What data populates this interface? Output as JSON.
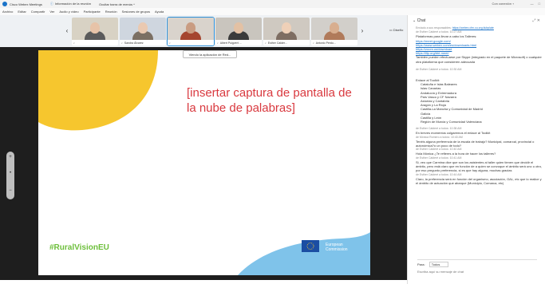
{
  "titlebar": {
    "app": "Cisco Webex Meetings",
    "info": "Información de la reunión",
    "hide": "Ocultar barra de menús ^",
    "connected": "Con conexión ∘",
    "win_min": "—",
    "win_close": "□"
  },
  "menu": [
    "Archivo",
    "Editar",
    "Compartir",
    "Ver",
    "Audio y vídeo",
    "Participante",
    "Reunión",
    "Sesiones de grupos",
    "Ayuda"
  ],
  "participants": [
    {
      "name": "",
      "bg": "#d8d2c4",
      "skin": "#e7c3a8",
      "shirt": "#5b5b5b"
    },
    {
      "name": "Sandra Álvarez",
      "bg": "#cfd6df",
      "skin": "#eac9b1",
      "shirt": "#7b6f63"
    },
    {
      "name": "",
      "bg": "#d9d3cc",
      "skin": "#c99c82",
      "shirt": "#a5452f",
      "active": true
    },
    {
      "name": "Albert Puigvert ...",
      "bg": "#c9c5be",
      "skin": "#e3c1a4",
      "shirt": "#3b3b3b"
    },
    {
      "name": "Esther Calder...",
      "bg": "#cfc9c1",
      "skin": "#efd0b8",
      "shirt": "#7e6d62"
    },
    {
      "name": "Antonio Perdo...",
      "bg": "#d2cfca",
      "skin": "#d8ae8f",
      "shirt": "#b07a5a"
    }
  ],
  "design_label": "Diseño",
  "viewing_label": "Viendo la aplicación de Red...",
  "slide": {
    "placeholder": "[insertar captura de pantalla de la nube de palabras]",
    "hashtag": "#RuralVisionEU",
    "eu_label_1": "European",
    "eu_label_2": "Commission",
    "colors": {
      "yellow": "#f6c62e",
      "blue": "#7fc3ea",
      "accent_red": "#d9393f",
      "hashtag_green": "#6dbf3b",
      "eu_blue": "#1b4ea3"
    }
  },
  "zoom": {
    "plus": "+",
    "minus": "−"
  },
  "chat": {
    "title": "Chat",
    "intro": "Enviado a sus responsables:",
    "intro_link": "https://webex.cfm.cu.org.tiubplate",
    "messages": [
      {
        "meta": "de Esther Calderé a todos: 10:27 AM",
        "lines": [
          "Plataformas para llevar a cabo los Talleres:"
        ]
      },
      {
        "meta": "",
        "links": [
          "https://meet.google.com/",
          "https://www.webex.com/es/downloads.html",
          "https://zoom.us/download",
          "https://lllp.org/bbl-meet/"
        ]
      },
      {
        "meta": "",
        "lines": [
          "También pueden efectuarse por Skype (integrado en el paquete de Microsoft) o cualquier otra plataforma que consideren adecuada"
        ]
      },
      {
        "meta": "de Esther Calderé a todos: 10:30 AM",
        "lines": []
      },
      {
        "meta": "",
        "lines": [
          "Enlace al Toolkit:"
        ],
        "indented": [
          "Cataluña e Islas Baleares",
          "Islas Canarias",
          "Andalucía y Extremadura",
          "País Vasco y CF Navarra",
          "Asturias y Cantabria",
          "Aragón y La Rioja",
          "Castilla-La Mancha y Comunidad de Madrid",
          "Galicia",
          "Castilla y León",
          "Región de Murcia y Comunidad Valenciana"
        ]
      },
      {
        "meta": "de Esther Calderé a todos: 10:38 AM",
        "lines": [
          "En breves momentos colgaremos el enlace al Toolkit"
        ]
      },
      {
        "meta": "de Mónica Romero a todos: 10:40 AM",
        "lines": [
          "Tenéis alguna preferencia de la escala de trabajo? Municipal, comarcal, provincial o autonómica?o un poco de todo?"
        ]
      },
      {
        "meta": "de Esther Calderé a todos: 10:40 AM",
        "lines": [
          "Hola Mónica ¿Te refieres a la hora de hacer los talleres?"
        ]
      },
      {
        "meta": "de Esther Calderé a todos: 10:41 AM",
        "lines": [
          "Si, veo que Carmina dice que son los asistentes al taller quien tienen que decidir el ámbito, pero está claro que en función de a quien se convoque el ámbito será uno u otro, por eso pregunto preferencia, si es que hay alguna, muchas gracias"
        ]
      },
      {
        "meta": "de Esther Calderé a todos: 10:44 AM",
        "lines": [
          "Claro, la preferencia será en función del organismo, asociación, GAL, etc que lo realice y el ámbito de actuación que abarque (Municipio, Comarca, etc)"
        ]
      }
    ],
    "to_label": "Para:",
    "to_value": "Todos",
    "input_placeholder": "Escriba aquí su mensaje de chat"
  }
}
